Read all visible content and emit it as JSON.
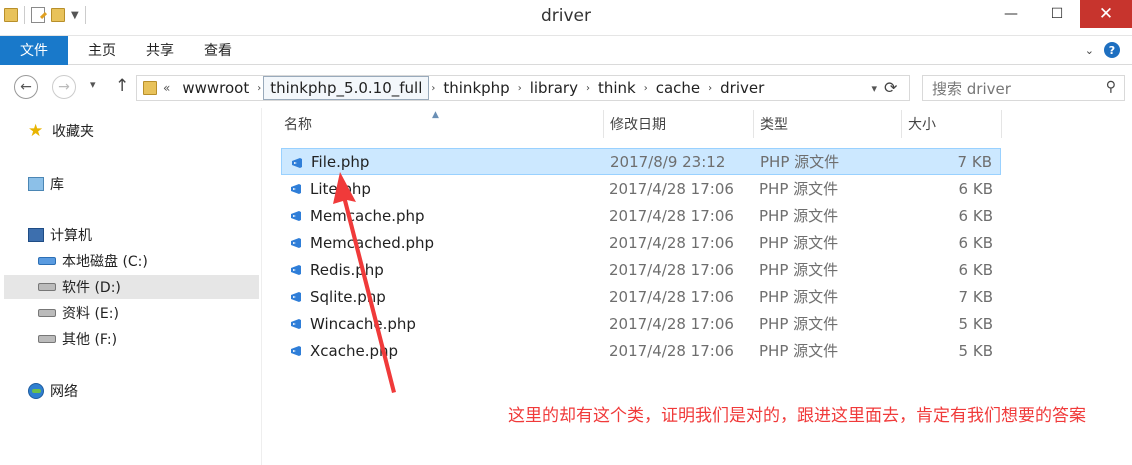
{
  "window": {
    "title": "driver",
    "min": "—",
    "max": "☐",
    "close": "✕"
  },
  "ribbon": {
    "tabs": [
      {
        "label": "文件",
        "active": true
      },
      {
        "label": "主页"
      },
      {
        "label": "共享"
      },
      {
        "label": "查看"
      }
    ],
    "help": "?"
  },
  "nav": {
    "back": "←",
    "forward": "→",
    "recent": "▾",
    "up": "↑",
    "overflow": "«",
    "crumbs": [
      "wwwroot",
      "thinkphp_5.0.10_full",
      "thinkphp",
      "library",
      "think",
      "cache",
      "driver"
    ],
    "highlighted_crumb": "thinkphp_5.0.10_full",
    "refresh": "⟳",
    "search_placeholder": "搜索 driver",
    "search_icon": "search-icon"
  },
  "sidebar": {
    "favorites": "收藏夹",
    "library": "库",
    "computer": "计算机",
    "drives": [
      {
        "label": "本地磁盘 (C:)",
        "icon": "system-drive-icon"
      },
      {
        "label": "软件 (D:)",
        "icon": "drive-icon",
        "selected": true
      },
      {
        "label": "资料 (E:)",
        "icon": "drive-icon"
      },
      {
        "label": "其他 (F:)",
        "icon": "drive-icon"
      }
    ],
    "network": "网络"
  },
  "columns": {
    "name": "名称",
    "date": "修改日期",
    "type": "类型",
    "size": "大小"
  },
  "files": [
    {
      "name": "File.php",
      "date": "2017/8/9 23:12",
      "type": "PHP 源文件",
      "size": "7 KB",
      "selected": true
    },
    {
      "name": "Lite.php",
      "date": "2017/4/28 17:06",
      "type": "PHP 源文件",
      "size": "6 KB"
    },
    {
      "name": "Memcache.php",
      "date": "2017/4/28 17:06",
      "type": "PHP 源文件",
      "size": "6 KB"
    },
    {
      "name": "Memcached.php",
      "date": "2017/4/28 17:06",
      "type": "PHP 源文件",
      "size": "6 KB"
    },
    {
      "name": "Redis.php",
      "date": "2017/4/28 17:06",
      "type": "PHP 源文件",
      "size": "6 KB"
    },
    {
      "name": "Sqlite.php",
      "date": "2017/4/28 17:06",
      "type": "PHP 源文件",
      "size": "7 KB"
    },
    {
      "name": "Wincache.php",
      "date": "2017/4/28 17:06",
      "type": "PHP 源文件",
      "size": "5 KB"
    },
    {
      "name": "Xcache.php",
      "date": "2017/4/28 17:06",
      "type": "PHP 源文件",
      "size": "5 KB"
    }
  ],
  "annotation": {
    "text": "这里的却有这个类，证明我们是对的，跟进这里面去，肯定有我们想要的答案",
    "color": "#f03a3a"
  },
  "colors": {
    "accent": "#1979ca",
    "selection": "#cce8ff",
    "close": "#c7342d"
  }
}
